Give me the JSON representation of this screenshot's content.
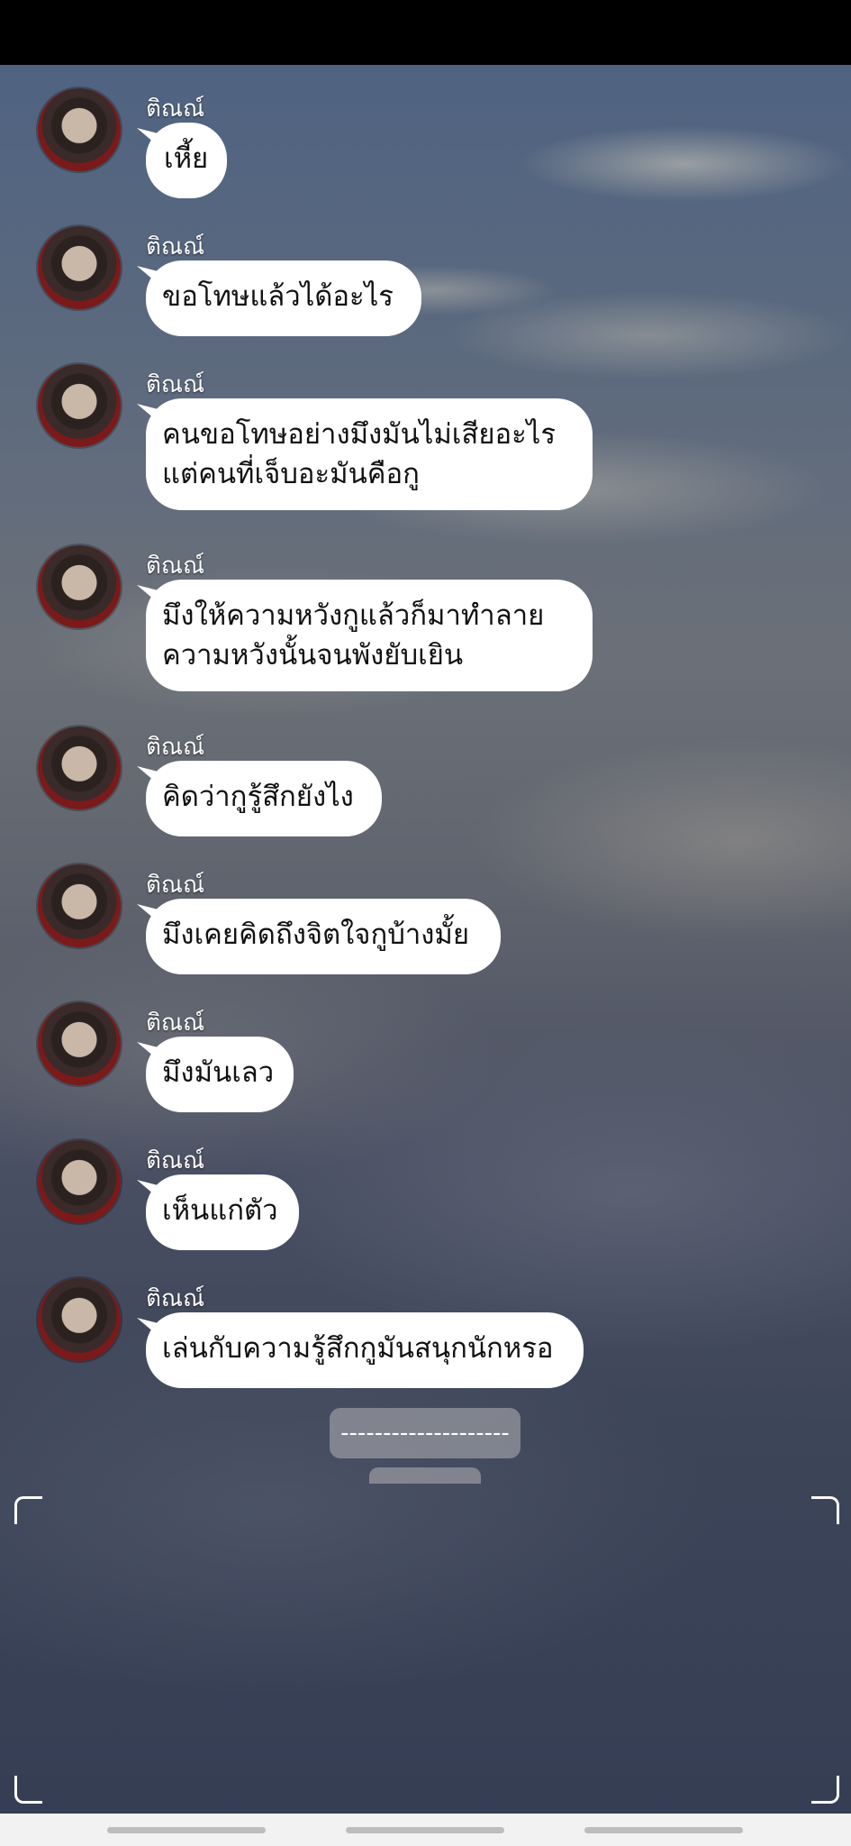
{
  "sender_name": "ติณณ์",
  "messages": [
    {
      "text": "เหี้ย"
    },
    {
      "text": "ขอโทษแล้วได้อะไร"
    },
    {
      "text": "คนขอโทษอย่างมึงมันไม่เสียอะไร\nแต่คนที่เจ็บอะมันคือกู"
    },
    {
      "text": "มึงให้ความหวังกูแล้วก็มาทำลาย\nความหวังนั้นจนพังยับเยิน"
    },
    {
      "text": "คิดว่ากูรู้สึกยังไง"
    },
    {
      "text": "มึงเคยคิดถึงจิตใจกูบ้างมั้ย"
    },
    {
      "text": "มึงมันเลว"
    },
    {
      "text": "เห็นแก่ตัว"
    },
    {
      "text": "เล่นกับความรู้สึกกูมันสนุกนักหรอ"
    }
  ],
  "divider": "--------------------"
}
